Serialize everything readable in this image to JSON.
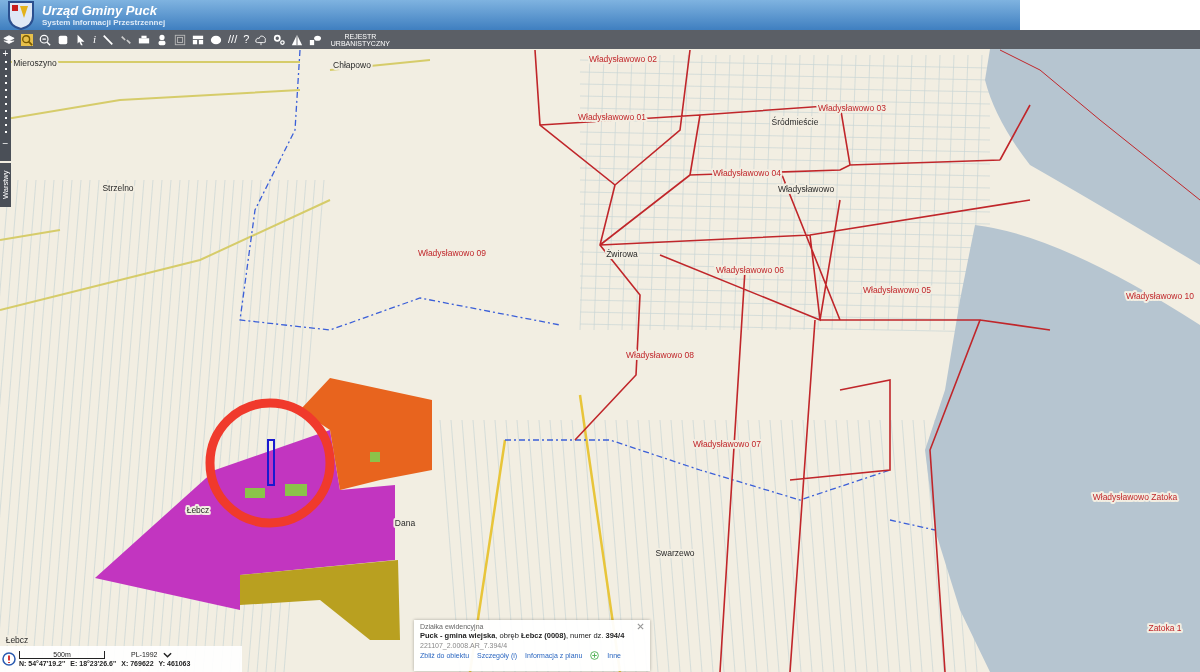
{
  "header": {
    "title": "Urząd Gminy Puck",
    "subtitle": "System Informacji Przestrzennej"
  },
  "toolbar": {
    "glyphs": [
      "i",
      "///",
      "?"
    ],
    "register_button": "REJESTR URBANISTYCZNY"
  },
  "zoom_bar": {
    "plus": "+",
    "minus": "−",
    "layers_tab": "Warstwy"
  },
  "map": {
    "labels": [
      {
        "text": "Mieroszyno",
        "kind": "place"
      },
      {
        "text": "Chłapowo",
        "kind": "place"
      },
      {
        "text": "Władysławowo 02",
        "kind": "district"
      },
      {
        "text": "Władysławowo 01",
        "kind": "district"
      },
      {
        "text": "Śródmieście",
        "kind": "place"
      },
      {
        "text": "Władysławowo 03",
        "kind": "district"
      },
      {
        "text": "Strzelno",
        "kind": "place"
      },
      {
        "text": "Władysławowo 04",
        "kind": "district"
      },
      {
        "text": "Władysławowo",
        "kind": "place"
      },
      {
        "text": "Władysławowo 09",
        "kind": "district"
      },
      {
        "text": "Żwirowa",
        "kind": "place"
      },
      {
        "text": "Władysławowo 06",
        "kind": "district"
      },
      {
        "text": "Władysławowo 05",
        "kind": "district"
      },
      {
        "text": "Władysławowo 10",
        "kind": "district"
      },
      {
        "text": "Władysławowo 08",
        "kind": "district"
      },
      {
        "text": "Władysławowo 07",
        "kind": "district"
      },
      {
        "text": "Władysławowo Zatoka",
        "kind": "district"
      },
      {
        "text": "Łebcz",
        "kind": "place"
      },
      {
        "text": "Dana",
        "kind": "place"
      },
      {
        "text": "Swarzewo",
        "kind": "place"
      },
      {
        "text": "Zatoka 1",
        "kind": "district"
      },
      {
        "text": "Łebcz",
        "kind": "place"
      }
    ]
  },
  "popup": {
    "title": "Działka ewidencyjna",
    "description": "**Puck - gmina wiejska**, obręb **Łebcz (0008)**, numer dz. **394/4**",
    "parcel_id": "221107_2.0008.AR_7.394/4",
    "links": [
      "Zbliż do obiektu",
      "Szczegóły (i)",
      "Informacja z planu"
    ],
    "more_link": "Inne"
  },
  "status": {
    "scale": "500m",
    "crs": "PL-1992",
    "n": "N: 54°47'19.2''",
    "e": "E: 18°23'26.6''",
    "x": "X: 769622",
    "y": "Y: 461063"
  }
}
